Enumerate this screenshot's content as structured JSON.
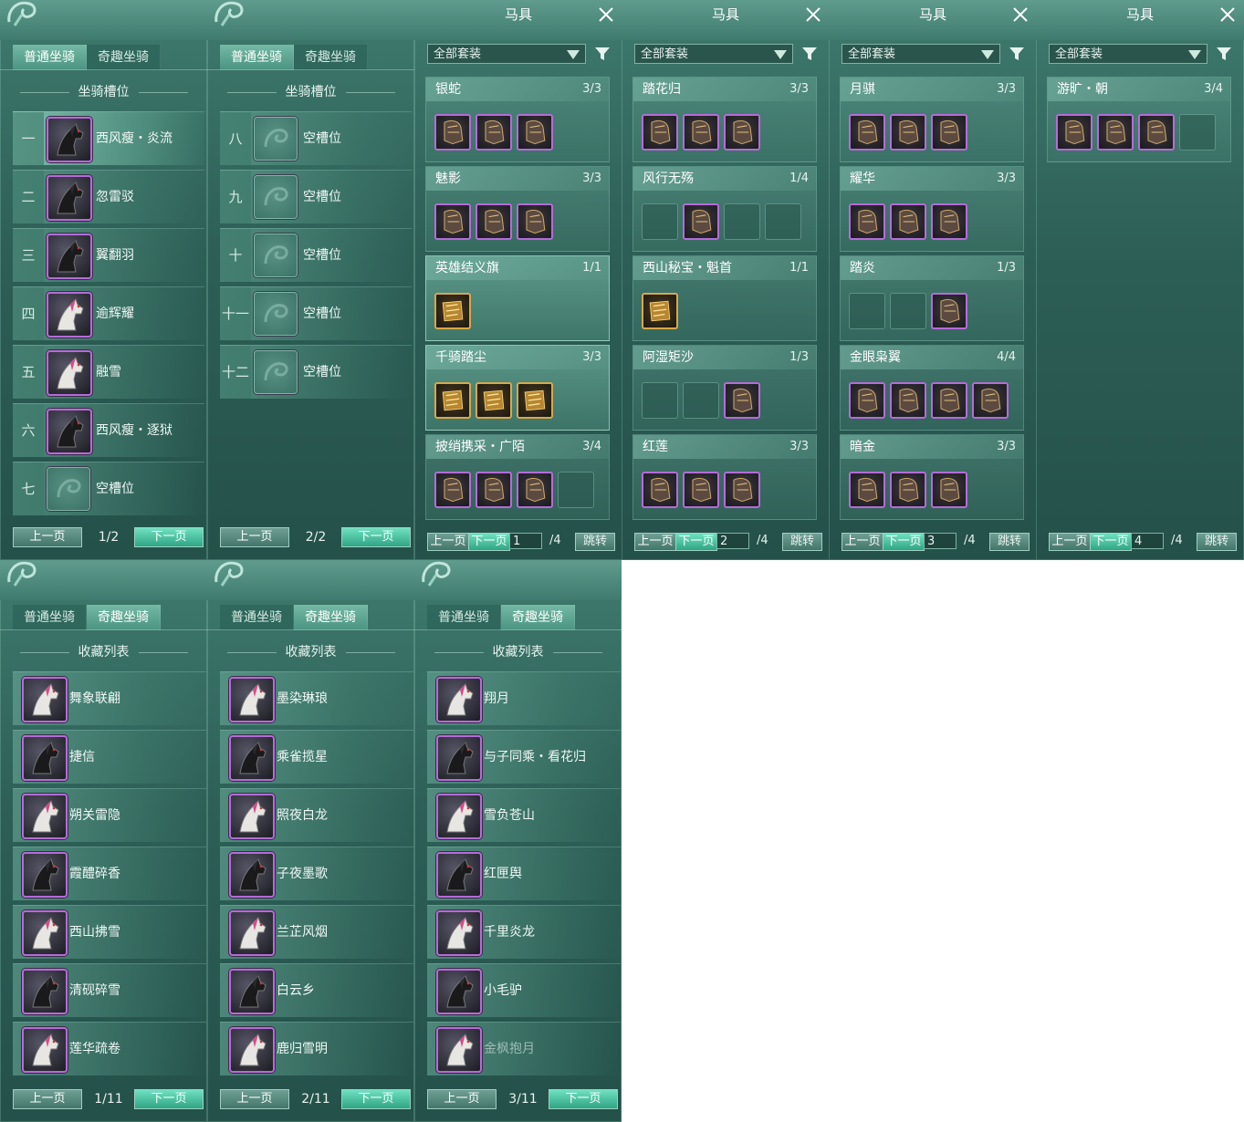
{
  "colors": {
    "accent": "#4a9481",
    "highlight": "#2fa584",
    "purple_frame": "#b66bd8",
    "gold_frame": "#d8a84a"
  },
  "mount_panels": [
    {
      "tabs": [
        "普通坐骑",
        "奇趣坐骑"
      ],
      "active_tab": 0,
      "section_title": "坐骑槽位",
      "slots": [
        {
          "num": "一",
          "name": "西风瘦・炎流",
          "icon": "black-horse-icon"
        },
        {
          "num": "二",
          "name": "忽雷驳",
          "icon": "black-horse-icon"
        },
        {
          "num": "三",
          "name": "翼翻羽",
          "icon": "black-horse-icon"
        },
        {
          "num": "四",
          "name": "逾辉耀",
          "icon": "white-horse-icon"
        },
        {
          "num": "五",
          "name": "融雪",
          "icon": "white-horse-icon"
        },
        {
          "num": "六",
          "name": "西风瘦・逐狱",
          "icon": "black-horse-icon"
        },
        {
          "num": "七",
          "name": "空槽位",
          "icon": "empty-slot-icon"
        }
      ],
      "pager": {
        "prev": "上一页",
        "next": "下一页",
        "page": "1/2"
      }
    },
    {
      "tabs": [
        "普通坐骑",
        "奇趣坐骑"
      ],
      "active_tab": 0,
      "section_title": "坐骑槽位",
      "slots": [
        {
          "num": "八",
          "name": "空槽位",
          "icon": "empty-slot-icon"
        },
        {
          "num": "九",
          "name": "空槽位",
          "icon": "empty-slot-icon"
        },
        {
          "num": "十",
          "name": "空槽位",
          "icon": "empty-slot-icon"
        },
        {
          "num": "十一",
          "name": "空槽位",
          "icon": "empty-slot-icon"
        },
        {
          "num": "十二",
          "name": "空槽位",
          "icon": "empty-slot-icon"
        }
      ],
      "pager": {
        "prev": "上一页",
        "next": "下一页",
        "page": "2/2"
      }
    }
  ],
  "collection_panels": [
    {
      "tabs": [
        "普通坐骑",
        "奇趣坐骑"
      ],
      "active_tab": 1,
      "section_title": "收藏列表",
      "items": [
        "舞象联翩",
        "捷信",
        "朔关雷隐",
        "霞醴碎香",
        "西山拂雪",
        "清砚碎雪",
        "莲华疏卷"
      ],
      "pager": {
        "prev": "上一页",
        "next": "下一页",
        "page": "1/11"
      }
    },
    {
      "tabs": [
        "普通坐骑",
        "奇趣坐骑"
      ],
      "active_tab": 1,
      "section_title": "收藏列表",
      "items": [
        "墨染琳琅",
        "乘雀揽星",
        "照夜白龙",
        "子夜墨歌",
        "兰芷风烟",
        "白云乡",
        "鹿归雪明"
      ],
      "pager": {
        "prev": "上一页",
        "next": "下一页",
        "page": "2/11"
      }
    },
    {
      "tabs": [
        "普通坐骑",
        "奇趣坐骑"
      ],
      "active_tab": 1,
      "section_title": "收藏列表",
      "items": [
        "翔月",
        "与子同乘・看花归",
        "雪负苍山",
        "红匣舆",
        "千里炎龙",
        "小毛驴",
        "金枫抱月"
      ],
      "pager": {
        "prev": "上一页",
        "next": "下一页",
        "page": "3/11"
      }
    }
  ],
  "tack_panels": [
    {
      "title": "马具",
      "dropdown": "全部套装",
      "sets": [
        {
          "name": "银蛇",
          "count": "3/3",
          "items": [
            "purple",
            "purple",
            "purple"
          ]
        },
        {
          "name": "魅影",
          "count": "3/3",
          "items": [
            "purple",
            "purple",
            "purple"
          ]
        },
        {
          "name": "英雄结义旗",
          "count": "1/1",
          "items": [
            "gold"
          ]
        },
        {
          "name": "千骑踏尘",
          "count": "3/3",
          "items": [
            "gold",
            "gold",
            "gold"
          ]
        },
        {
          "name": "披绡携采・广陌",
          "count": "3/4",
          "items": [
            "purple",
            "purple",
            "purple",
            "empty"
          ]
        }
      ],
      "pager": {
        "prev": "上一页",
        "next": "下一页",
        "page": "1",
        "total": "/4",
        "jump": "跳转"
      }
    },
    {
      "title": "马具",
      "dropdown": "全部套装",
      "sets": [
        {
          "name": "踏花归",
          "count": "3/3",
          "items": [
            "purple",
            "purple",
            "purple"
          ]
        },
        {
          "name": "风行无殇",
          "count": "1/4",
          "items": [
            "empty",
            "purple",
            "empty",
            "empty"
          ]
        },
        {
          "name": "西山秘宝・魁首",
          "count": "1/1",
          "items": [
            "gold"
          ]
        },
        {
          "name": "阿湿矩沙",
          "count": "1/3",
          "items": [
            "empty",
            "empty",
            "purple"
          ]
        },
        {
          "name": "红莲",
          "count": "3/3",
          "items": [
            "purple",
            "purple",
            "purple"
          ]
        }
      ],
      "pager": {
        "prev": "上一页",
        "next": "下一页",
        "page": "2",
        "total": "/4",
        "jump": "跳转"
      }
    },
    {
      "title": "马具",
      "dropdown": "全部套装",
      "sets": [
        {
          "name": "月骐",
          "count": "3/3",
          "items": [
            "purple",
            "purple",
            "purple"
          ]
        },
        {
          "name": "耀华",
          "count": "3/3",
          "items": [
            "purple",
            "purple",
            "purple"
          ]
        },
        {
          "name": "踏炎",
          "count": "1/3",
          "items": [
            "empty",
            "empty",
            "purple"
          ]
        },
        {
          "name": "金眼枭翼",
          "count": "4/4",
          "items": [
            "purple",
            "purple",
            "purple",
            "purple"
          ]
        },
        {
          "name": "暗金",
          "count": "3/3",
          "items": [
            "purple",
            "purple",
            "purple"
          ]
        }
      ],
      "pager": {
        "prev": "上一页",
        "next": "下一页",
        "page": "3",
        "total": "/4",
        "jump": "跳转"
      }
    },
    {
      "title": "马具",
      "dropdown": "全部套装",
      "sets": [
        {
          "name": "游旷・朝",
          "count": "3/4",
          "items": [
            "purple",
            "purple",
            "purple",
            "empty"
          ]
        }
      ],
      "pager": {
        "prev": "上一页",
        "next": "下一页",
        "page": "4",
        "total": "/4",
        "jump": "跳转"
      }
    }
  ]
}
